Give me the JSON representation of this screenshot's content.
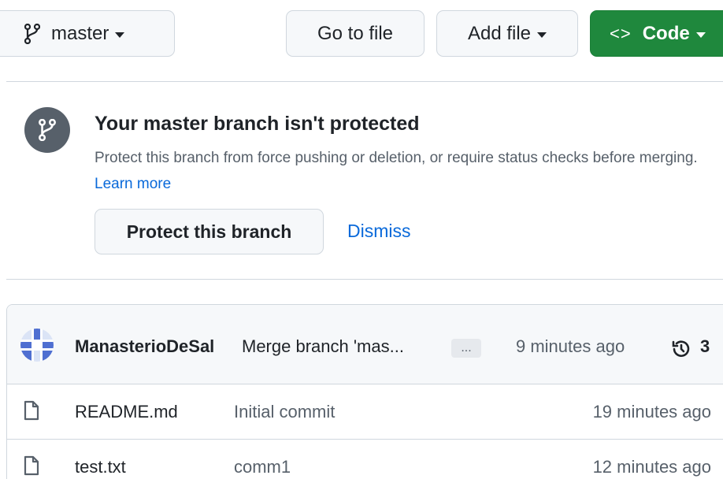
{
  "toolbar": {
    "branch_label": "master",
    "go_to_file_label": "Go to file",
    "add_file_label": "Add file",
    "code_label": "Code",
    "code_icon_glyph": "<>"
  },
  "banner": {
    "title": "Your master branch isn't protected",
    "description": "Protect this branch from force pushing or deletion, or require status checks before merging.",
    "learn_more": "Learn more",
    "protect_label": "Protect this branch",
    "dismiss_label": "Dismiss"
  },
  "commit": {
    "author": "ManasterioDeSal",
    "message": "Merge branch 'mas...",
    "ellipsis": "...",
    "time": "9 minutes ago",
    "history_count": "3"
  },
  "files": [
    {
      "name": "README.md",
      "commit": "Initial commit",
      "time": "19 minutes ago"
    },
    {
      "name": "test.txt",
      "commit": "comm1",
      "time": "12 minutes ago"
    }
  ],
  "colors": {
    "accent_green": "#1f883d",
    "link_blue": "#0969da",
    "muted_text": "#57606a",
    "border": "#d0d7de"
  },
  "icons": {
    "branch": "git-branch-icon",
    "history": "history-icon",
    "file": "file-icon"
  }
}
